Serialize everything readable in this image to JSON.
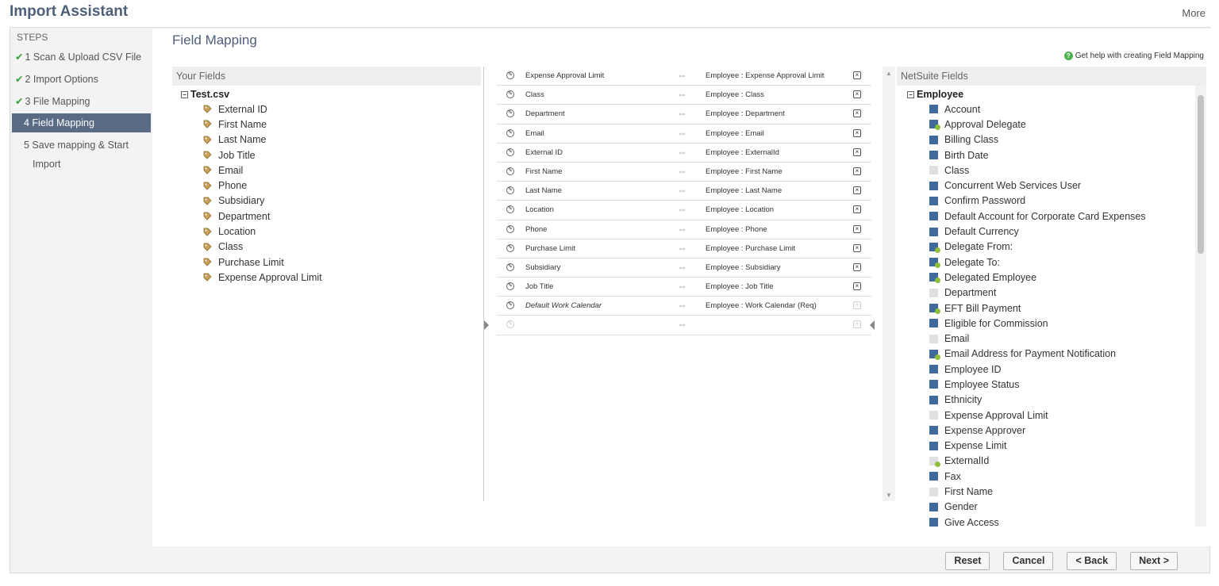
{
  "app": {
    "title": "Import Assistant",
    "more_label": "More"
  },
  "steps": {
    "header": "STEPS",
    "items": [
      {
        "label": "1 Scan & Upload CSV File",
        "done": true
      },
      {
        "label": "2 Import Options",
        "done": true
      },
      {
        "label": "3 File Mapping",
        "done": true
      },
      {
        "label": "4 Field Mapping",
        "active": true
      },
      {
        "label": "5 Save mapping & Start",
        "label2": "Import"
      }
    ]
  },
  "main": {
    "title": "Field Mapping",
    "help_link": "Get help with creating Field Mapping"
  },
  "your_fields": {
    "header": "Your Fields",
    "file": "Test.csv",
    "items": [
      "External ID",
      "First Name",
      "Last Name",
      "Job Title",
      "Email",
      "Phone",
      "Subsidiary",
      "Department",
      "Location",
      "Class",
      "Purchase Limit",
      "Expense Approval Limit"
    ]
  },
  "mappings": [
    {
      "source": "Expense Approval Limit",
      "target": "Employee : Expense Approval Limit"
    },
    {
      "source": "Class",
      "target": "Employee : Class"
    },
    {
      "source": "Department",
      "target": "Employee : Department"
    },
    {
      "source": "Email",
      "target": "Employee : Email"
    },
    {
      "source": "External ID",
      "target": "Employee : ExternalId"
    },
    {
      "source": "First Name",
      "target": "Employee : First Name"
    },
    {
      "source": "Last Name",
      "target": "Employee : Last Name"
    },
    {
      "source": "Location",
      "target": "Employee : Location"
    },
    {
      "source": "Phone",
      "target": "Employee : Phone"
    },
    {
      "source": "Purchase Limit",
      "target": "Employee : Purchase Limit"
    },
    {
      "source": "Subsidiary",
      "target": "Employee : Subsidiary"
    },
    {
      "source": "Job Title",
      "target": "Employee : Job Title"
    },
    {
      "source": "Default Work Calendar",
      "target": "Employee : Work Calendar (Req)",
      "default": true
    },
    {
      "source": "",
      "target": "",
      "empty": true
    }
  ],
  "netsuite_fields": {
    "header": "NetSuite Fields",
    "record": "Employee",
    "items": [
      {
        "label": "Account",
        "icon": "solid"
      },
      {
        "label": "Approval Delegate",
        "icon": "solid-badge"
      },
      {
        "label": "Billing Class",
        "icon": "solid"
      },
      {
        "label": "Birth Date",
        "icon": "solid"
      },
      {
        "label": "Class",
        "icon": "faint"
      },
      {
        "label": "Concurrent Web Services User",
        "icon": "solid"
      },
      {
        "label": "Confirm Password",
        "icon": "solid"
      },
      {
        "label": "Default Account for Corporate Card Expenses",
        "icon": "solid"
      },
      {
        "label": "Default Currency",
        "icon": "solid"
      },
      {
        "label": "Delegate From:",
        "icon": "solid-badge"
      },
      {
        "label": "Delegate To:",
        "icon": "solid-badge"
      },
      {
        "label": "Delegated Employee",
        "icon": "solid-badge"
      },
      {
        "label": "Department",
        "icon": "faint"
      },
      {
        "label": "EFT Bill Payment",
        "icon": "solid-badge"
      },
      {
        "label": "Eligible for Commission",
        "icon": "solid"
      },
      {
        "label": "Email",
        "icon": "faint"
      },
      {
        "label": "Email Address for Payment Notification",
        "icon": "solid-badge"
      },
      {
        "label": "Employee ID",
        "icon": "solid"
      },
      {
        "label": "Employee Status",
        "icon": "solid"
      },
      {
        "label": "Ethnicity",
        "icon": "solid"
      },
      {
        "label": "Expense Approval Limit",
        "icon": "faint"
      },
      {
        "label": "Expense Approver",
        "icon": "solid"
      },
      {
        "label": "Expense Limit",
        "icon": "solid"
      },
      {
        "label": "ExternalId",
        "icon": "faint-badge"
      },
      {
        "label": "Fax",
        "icon": "solid"
      },
      {
        "label": "First Name",
        "icon": "faint"
      },
      {
        "label": "Gender",
        "icon": "solid"
      },
      {
        "label": "Give Access",
        "icon": "solid"
      }
    ]
  },
  "footer": {
    "reset": "Reset",
    "cancel": "Cancel",
    "back": "< Back",
    "next": "Next >"
  },
  "colors": {
    "title": "#4d5f79",
    "active_step": "#5a6b85",
    "check": "#3ba13b",
    "field_icon": "#3f6a9b"
  }
}
